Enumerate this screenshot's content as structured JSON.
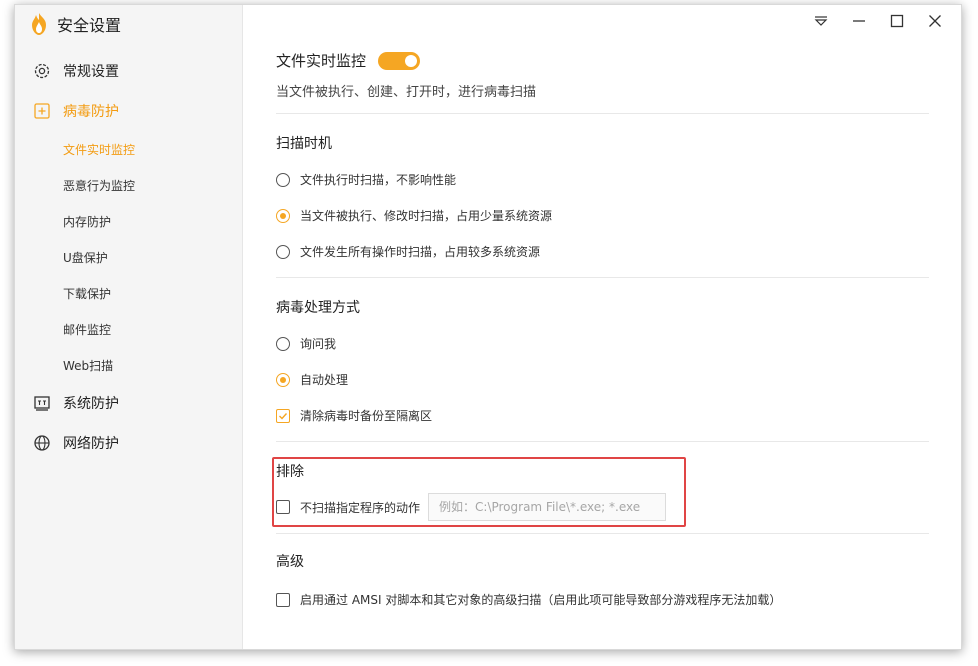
{
  "app": {
    "title": "安全设置"
  },
  "colors": {
    "accent": "#f5a623",
    "highlight": "#e04545"
  },
  "sidebar": {
    "items": [
      {
        "label": "常规设置",
        "icon": "gear-icon"
      },
      {
        "label": "病毒防护",
        "icon": "plus-square-icon",
        "active": true
      },
      {
        "label": "系统防护",
        "icon": "system-icon"
      },
      {
        "label": "网络防护",
        "icon": "globe-icon"
      }
    ],
    "subitems": [
      {
        "label": "文件实时监控",
        "active": true
      },
      {
        "label": "恶意行为监控"
      },
      {
        "label": "内存防护"
      },
      {
        "label": "U盘保护"
      },
      {
        "label": "下载保护"
      },
      {
        "label": "邮件监控"
      },
      {
        "label": "Web扫描"
      }
    ]
  },
  "main": {
    "realtime": {
      "title": "文件实时监控",
      "enabled": true,
      "desc": "当文件被执行、创建、打开时，进行病毒扫描"
    },
    "scan_timing": {
      "title": "扫描时机",
      "options": [
        {
          "label": "文件执行时扫描，不影响性能",
          "checked": false
        },
        {
          "label": "当文件被执行、修改时扫描，占用少量系统资源",
          "checked": true
        },
        {
          "label": "文件发生所有操作时扫描，占用较多系统资源",
          "checked": false
        }
      ]
    },
    "handling": {
      "title": "病毒处理方式",
      "options": [
        {
          "label": "询问我",
          "checked": false
        },
        {
          "label": "自动处理",
          "checked": true
        }
      ],
      "backup": {
        "label": "清除病毒时备份至隔离区",
        "checked": true
      }
    },
    "exclude": {
      "title": "排除",
      "checkbox_label": "不扫描指定程序的动作",
      "checked": false,
      "placeholder": "例如：C:\\Program File\\*.exe; *.exe"
    },
    "advanced": {
      "title": "高级",
      "checkbox_label": "启用通过 AMSI 对脚本和其它对象的高级扫描（启用此项可能导致部分游戏程序无法加载）",
      "checked": false
    }
  }
}
